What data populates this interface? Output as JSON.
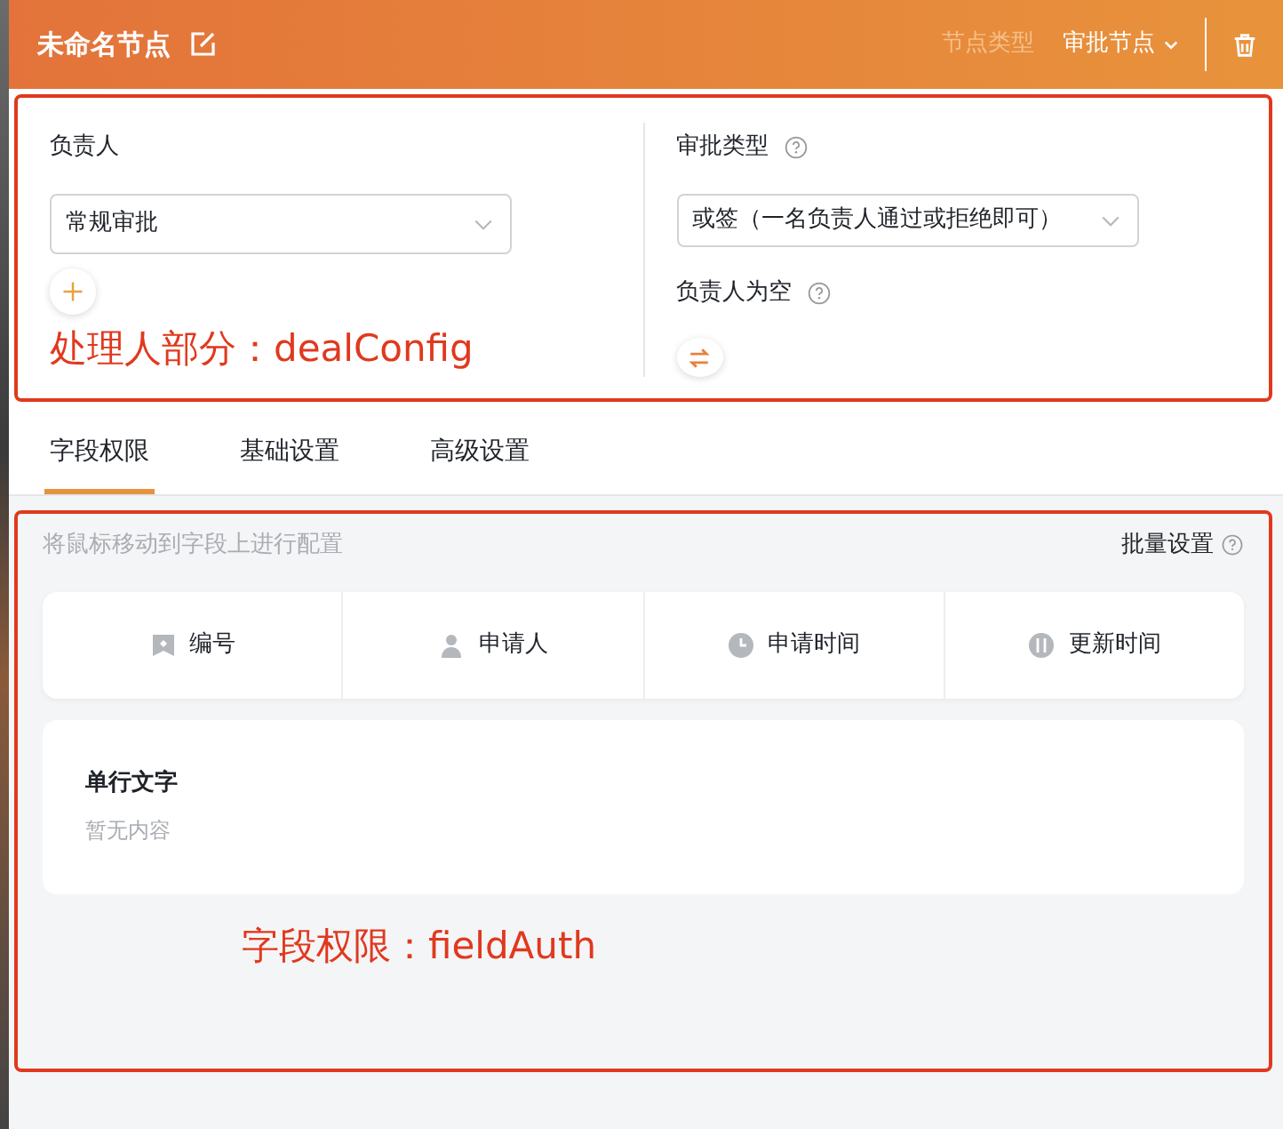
{
  "header": {
    "title": "未命名节点",
    "type_label": "节点类型",
    "type_value": "审批节点"
  },
  "deal_config": {
    "owner_label": "负责人",
    "owner_value": "常规审批",
    "annotation": "处理人部分：dealConfig",
    "approval_type_label": "审批类型",
    "approval_type_value": "或签（一名负责人通过或拒绝即可）",
    "empty_owner_label": "负责人为空"
  },
  "tabs": [
    {
      "label": "字段权限",
      "selected": true
    },
    {
      "label": "基础设置",
      "selected": false
    },
    {
      "label": "高级设置",
      "selected": false
    }
  ],
  "field_auth": {
    "hint": "将鼠标移动到字段上进行配置",
    "batch_label": "批量设置",
    "system_fields": [
      {
        "kind": "id",
        "label": "编号"
      },
      {
        "kind": "user",
        "label": "申请人"
      },
      {
        "kind": "clock",
        "label": "申请时间"
      },
      {
        "kind": "update",
        "label": "更新时间"
      }
    ],
    "fields": [
      {
        "label": "单行文字",
        "empty_text": "暂无内容"
      }
    ],
    "annotation": "字段权限：fieldAuth"
  }
}
